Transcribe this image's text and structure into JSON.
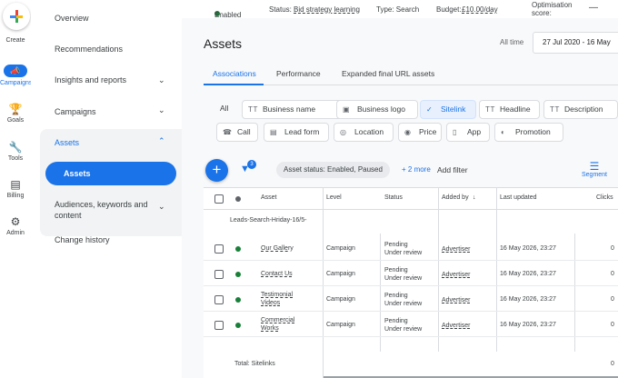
{
  "rail": {
    "create": "Create",
    "campaigns": "Campaigns",
    "goals": "Goals",
    "tools": "Tools",
    "billing": "Billing",
    "admin": "Admin"
  },
  "sidenav": {
    "overview": "Overview",
    "recommendations": "Recommendations",
    "insights": "Insights and reports",
    "campaigns": "Campaigns",
    "assets_group": "Assets",
    "assets": "Assets",
    "audiences": "Audiences, keywords and content",
    "change_history": "Change history"
  },
  "topbar": {
    "enabled": "Enabled",
    "status_label": "Status:",
    "status_value": "Bid strategy learning",
    "type": "Type: Search",
    "budget_label": "Budget:",
    "budget_value": "£10.00/day",
    "opt_score": "Optimisation score:"
  },
  "page": {
    "title": "Assets",
    "all_time": "All time",
    "date_range": "27 Jul 2020 - 16 May"
  },
  "tabs": [
    "Associations",
    "Performance",
    "Expanded final URL assets"
  ],
  "chips": {
    "all": "All",
    "business_name": "Business name",
    "business_logo": "Business logo",
    "sitelink": "Sitelink",
    "headline": "Headline",
    "description": "Description",
    "call": "Call",
    "lead_form": "Lead form",
    "location": "Location",
    "price": "Price",
    "app": "App",
    "promotion": "Promotion"
  },
  "toolbar": {
    "filter_count": "3",
    "filter_chip": "Asset status: Enabled, Paused",
    "more": "+ 2 more",
    "add_filter": "Add filter",
    "segment": "Segment"
  },
  "table": {
    "headers": {
      "asset": "Asset",
      "level": "Level",
      "status": "Status",
      "added_by": "Added by",
      "last_updated": "Last updated",
      "clicks": "Clicks"
    },
    "group": "Leads-Search-Hriday-16/5-",
    "rows": [
      {
        "asset": "Our Gallery",
        "level": "Campaign",
        "status": "Pending Under review",
        "added_by": "Advertiser",
        "updated": "16 May 2026, 23:27",
        "clicks": "0"
      },
      {
        "asset": "Contact Us",
        "level": "Campaign",
        "status": "Pending Under review",
        "added_by": "Advertiser",
        "updated": "16 May 2026, 23:27",
        "clicks": "0"
      },
      {
        "asset": "Testimonial Videos",
        "level": "Campaign",
        "status": "Pending Under review",
        "added_by": "Advertiser",
        "updated": "16 May 2026, 23:27",
        "clicks": "0"
      },
      {
        "asset": "Commercial Works",
        "level": "Campaign",
        "status": "Pending Under review",
        "added_by": "Advertiser",
        "updated": "16 May 2026, 23:27",
        "clicks": "0"
      }
    ],
    "total_label": "Total: Sitelinks",
    "total_clicks": "0"
  }
}
